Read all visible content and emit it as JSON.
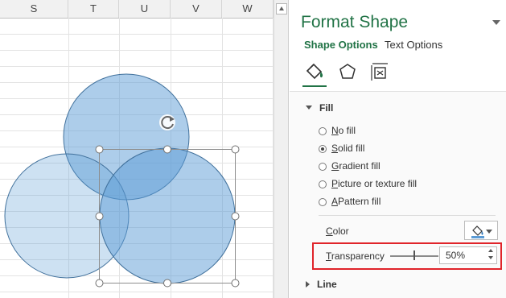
{
  "sheet": {
    "columns": [
      "S",
      "T",
      "U",
      "V",
      "W"
    ]
  },
  "pane": {
    "title": "Format Shape",
    "tabs": {
      "shape_options": "Shape Options",
      "text_options": "Text Options"
    },
    "icons": [
      "fill-line-icon",
      "effects-pentagon-icon",
      "size-properties-icon"
    ],
    "fill": {
      "header": "Fill",
      "options": [
        {
          "underline": "N",
          "rest": "o fill",
          "checked": false
        },
        {
          "underline": "S",
          "rest": "olid fill",
          "checked": true
        },
        {
          "underline": "G",
          "rest": "radient fill",
          "checked": false
        },
        {
          "underline": "P",
          "rest": "icture or texture fill",
          "checked": false
        },
        {
          "underline": "A",
          "rest": "Pattern fill",
          "checked": false
        }
      ],
      "color_label_u": "C",
      "color_label_rest": "olor",
      "transparency_label_u": "T",
      "transparency_label_rest": "ransparency",
      "transparency_value": "50%",
      "transparency_level": 50
    },
    "line_header": "Line"
  },
  "colors": {
    "accent": "#217346",
    "highlight": "#e0242a",
    "circle_fill": "#5b9bd5",
    "circle_stroke": "#41719c"
  }
}
